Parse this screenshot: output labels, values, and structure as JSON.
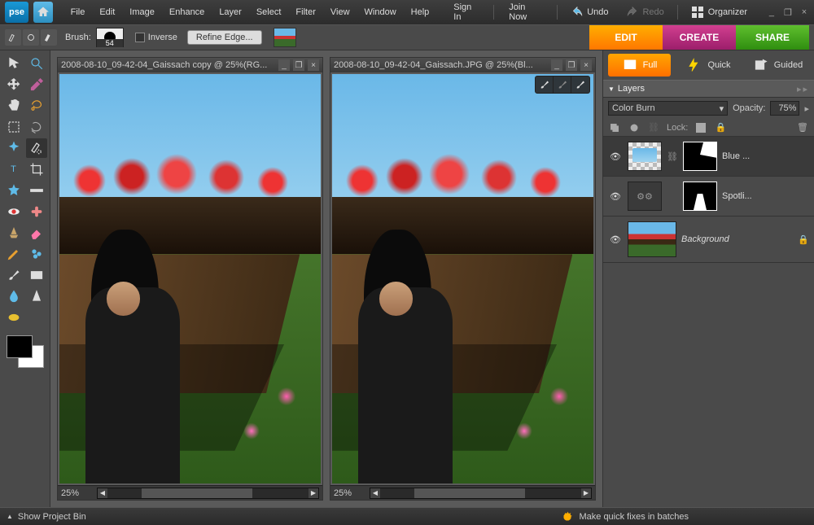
{
  "app": {
    "logo": "pse"
  },
  "menu": [
    "File",
    "Edit",
    "Image",
    "Enhance",
    "Layer",
    "Select",
    "Filter",
    "View",
    "Window",
    "Help"
  ],
  "account": {
    "sign_in": "Sign In",
    "join_now": "Join Now"
  },
  "history": {
    "undo": "Undo",
    "redo": "Redo"
  },
  "organizer": "Organizer",
  "window_controls": {
    "minimize": "_",
    "restore": "❐",
    "close": "×"
  },
  "options": {
    "brush_label": "Brush:",
    "brush_size": "54",
    "inverse_label": "Inverse",
    "refine_edge": "Refine Edge..."
  },
  "modes": {
    "edit": "EDIT",
    "create": "CREATE",
    "share": "SHARE"
  },
  "tools": [
    [
      "arrow",
      "zoom"
    ],
    [
      "move",
      "eyedropper"
    ],
    [
      "hand",
      "lasso"
    ],
    [
      "marquee",
      "magnetic-lasso"
    ],
    [
      "magic-sel",
      "quick-sel"
    ],
    [
      "type",
      "crop"
    ],
    [
      "cookie",
      "straighten"
    ],
    [
      "redeye",
      "spot-heal"
    ],
    [
      "clone",
      "eraser"
    ],
    [
      "pencil",
      "smart-brush"
    ],
    [
      "brush",
      "gradient"
    ],
    [
      "blur",
      "sharpen"
    ],
    [
      "sponge",
      ""
    ]
  ],
  "documents": [
    {
      "title": "2008-08-10_09-42-04_Gaissach copy @ 25%(RG...",
      "zoom": "25%"
    },
    {
      "title": "2008-08-10_09-42-04_Gaissach.JPG @ 25%(Bl...",
      "zoom": "25%"
    }
  ],
  "right_tabs": {
    "full": "Full",
    "quick": "Quick",
    "guided": "Guided"
  },
  "layers_panel": {
    "title": "Layers",
    "blend_mode": "Color Burn",
    "opacity_label": "Opacity:",
    "opacity": "75%",
    "lock_label": "Lock:",
    "layers": [
      {
        "name": "Blue ...",
        "type": "adjust",
        "mask": "top",
        "selected": true
      },
      {
        "name": "Spotli...",
        "type": "smart",
        "mask": "mid",
        "selected": false
      },
      {
        "name": "Background",
        "type": "bg",
        "locked": true,
        "selected": false
      }
    ]
  },
  "statusbar": {
    "project_bin": "Show Project Bin",
    "tip": "Make quick fixes in batches"
  }
}
